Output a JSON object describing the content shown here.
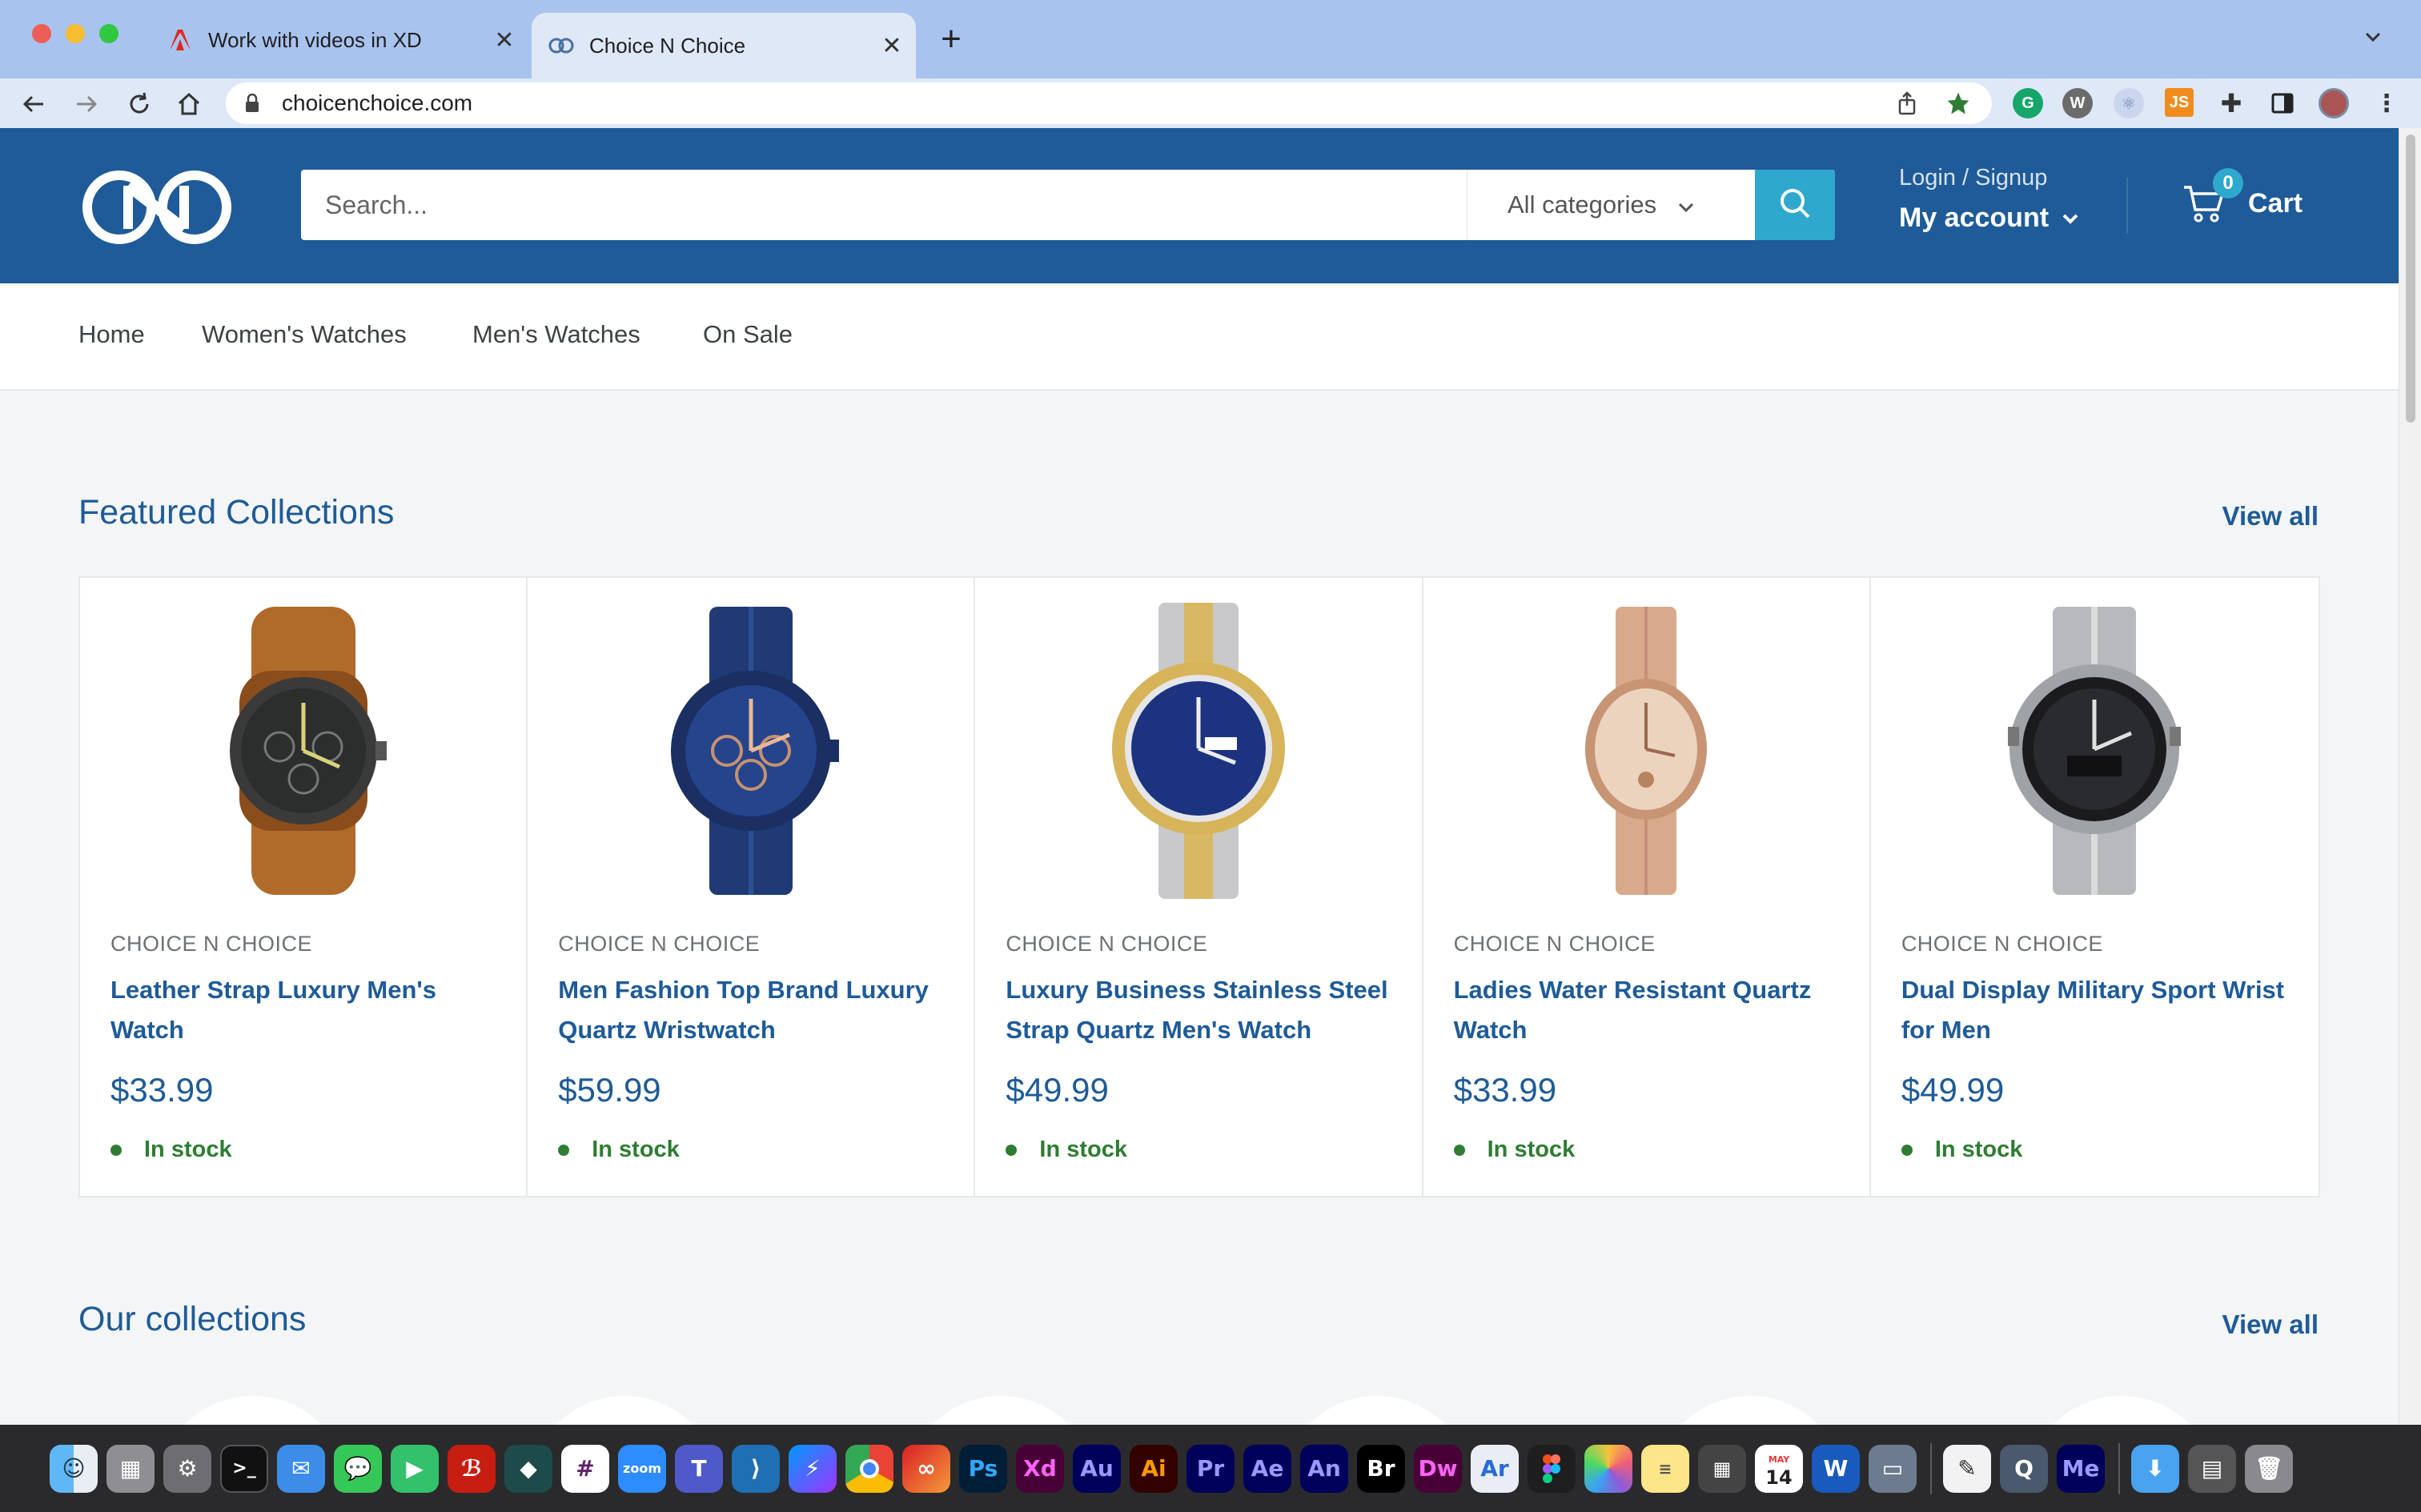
{
  "browser": {
    "tabs": [
      {
        "title": "Work with videos in XD",
        "favicon": "adobe-icon"
      },
      {
        "title": "Choice N Choice",
        "favicon": "link-icon",
        "active": true
      }
    ],
    "url": "choicenchoice.com"
  },
  "header": {
    "search_placeholder": "Search...",
    "category_select": "All categories",
    "login_label": "Login / Signup",
    "account_label": "My account",
    "cart_label": "Cart",
    "cart_count": "0"
  },
  "nav": {
    "items": [
      "Home",
      "Women's Watches",
      "Men's Watches",
      "On Sale"
    ]
  },
  "featured": {
    "title": "Featured Collections",
    "view_all": "View all",
    "products": [
      {
        "vendor": "CHOICE N CHOICE",
        "title": "Leather Strap Luxury Men's Watch",
        "price": "$33.99",
        "stock": "In stock"
      },
      {
        "vendor": "CHOICE N CHOICE",
        "title": "Men Fashion Top Brand Luxury Quartz Wristwatch",
        "price": "$59.99",
        "stock": "In stock"
      },
      {
        "vendor": "CHOICE N CHOICE",
        "title": "Luxury Business Stainless Steel Strap Quartz Men's Watch",
        "price": "$49.99",
        "stock": "In stock"
      },
      {
        "vendor": "CHOICE N CHOICE",
        "title": "Ladies Water Resistant Quartz Watch",
        "price": "$33.99",
        "stock": "In stock"
      },
      {
        "vendor": "CHOICE N CHOICE",
        "title": "Dual Display Military Sport Wrist for Men",
        "price": "$49.99",
        "stock": "In stock"
      }
    ]
  },
  "collections": {
    "title": "Our collections",
    "view_all": "View all"
  },
  "colors": {
    "brand": "#1e5b98",
    "accent": "#2fa8cd",
    "in_stock": "#2e7d32"
  },
  "dock": {
    "apps": [
      "Finder",
      "Launchpad",
      "System Preferences",
      "Terminal",
      "Mail",
      "Messages",
      "FaceTime",
      "Acrobat",
      "Filmora",
      "Slack",
      "Zoom",
      "Teams",
      "VS Code",
      "Messenger",
      "Chrome",
      "Creative Cloud",
      "Ps",
      "Xd",
      "Au",
      "Ai",
      "Pr",
      "Ae",
      "An",
      "Br",
      "Dw",
      "Ar",
      "Figma",
      "Photos",
      "Notes",
      "Calculator",
      "Calendar",
      "Word",
      "Preview",
      "TextEdit",
      "QuickTime",
      "Me",
      "Downloads",
      "Screenshot",
      "Trash"
    ],
    "labels": {
      "ps": "Ps",
      "xd": "Xd",
      "au": "Au",
      "ai": "Ai",
      "pr": "Pr",
      "ae": "Ae",
      "an": "An",
      "br": "Br",
      "dw": "Dw",
      "ar": "Ar",
      "me": "Me",
      "zoom": "zoom",
      "cal_month": "MAY",
      "cal_day": "14"
    }
  }
}
